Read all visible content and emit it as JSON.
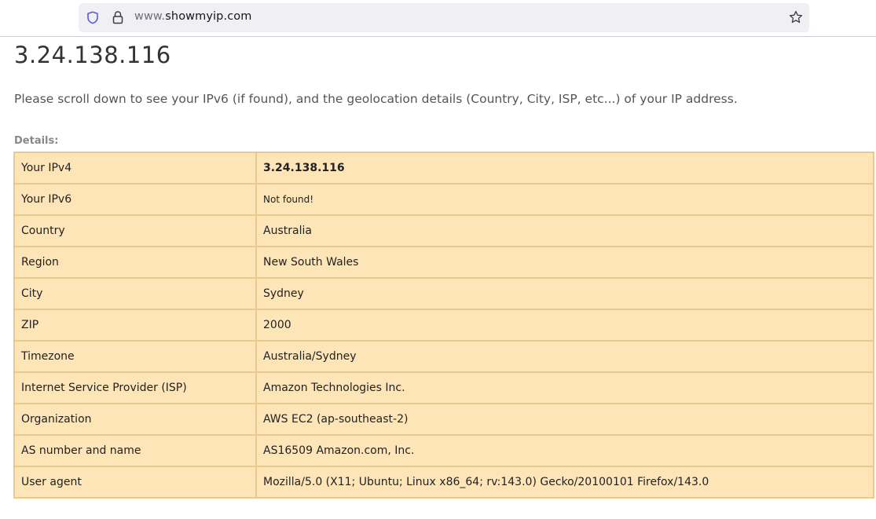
{
  "browser": {
    "url_prefix": "www.",
    "url_domain": "showmyip.com"
  },
  "page": {
    "heading": "3.24.138.116",
    "intro": "Please scroll down to see your IPv6 (if found), and the geolocation details (Country, City, ISP, etc...) of your IP address.",
    "details_label": "Details:"
  },
  "details": [
    {
      "label": "Your IPv4",
      "value": "3.24.138.116"
    },
    {
      "label": "Your IPv6",
      "value": "Not found!"
    },
    {
      "label": "Country",
      "value": "Australia"
    },
    {
      "label": "Region",
      "value": "New South Wales"
    },
    {
      "label": "City",
      "value": "Sydney"
    },
    {
      "label": "ZIP",
      "value": "2000"
    },
    {
      "label": "Timezone",
      "value": "Australia/Sydney"
    },
    {
      "label": "Internet Service Provider (ISP)",
      "value": "Amazon Technologies Inc."
    },
    {
      "label": "Organization",
      "value": "AWS EC2 (ap-southeast-2)"
    },
    {
      "label": "AS number and name",
      "value": "AS16509 Amazon.com, Inc."
    },
    {
      "label": "User agent",
      "value": "Mozilla/5.0 (X11; Ubuntu; Linux x86_64; rv:143.0) Gecko/20100101 Firefox/143.0"
    }
  ],
  "icons": {
    "tracking_protection": "shield-icon",
    "secure_connection": "lock-icon",
    "bookmark": "star-icon"
  },
  "colors": {
    "table_background": "#fde5b7",
    "table_border": "#e9c98d"
  }
}
